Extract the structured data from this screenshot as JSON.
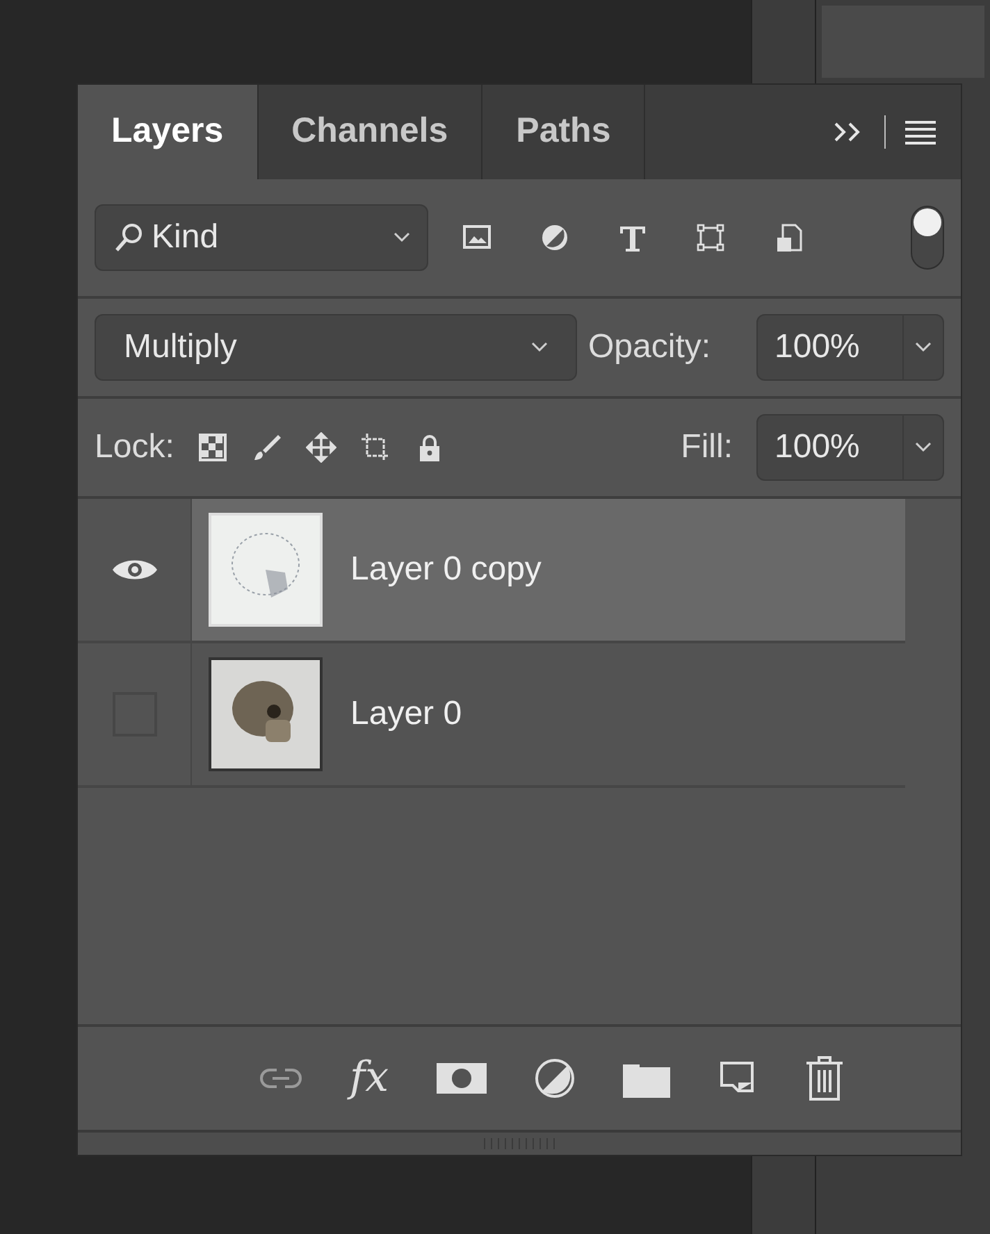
{
  "tabs": [
    {
      "label": "Layers",
      "selected": true
    },
    {
      "label": "Channels",
      "selected": false
    },
    {
      "label": "Paths",
      "selected": false
    }
  ],
  "filter": {
    "value": "Kind",
    "on": true
  },
  "blend": {
    "mode": "Multiply",
    "opacity_label": "Opacity:",
    "opacity": "100%"
  },
  "lock": {
    "label": "Lock:",
    "fill_label": "Fill:",
    "fill": "100%"
  },
  "layers": [
    {
      "name": "Layer 0 copy",
      "visible": true,
      "selected": true,
      "kind": "inverted"
    },
    {
      "name": "Layer 0",
      "visible": false,
      "selected": false,
      "kind": "photo"
    }
  ],
  "footer": {
    "effects_label": "fx"
  }
}
